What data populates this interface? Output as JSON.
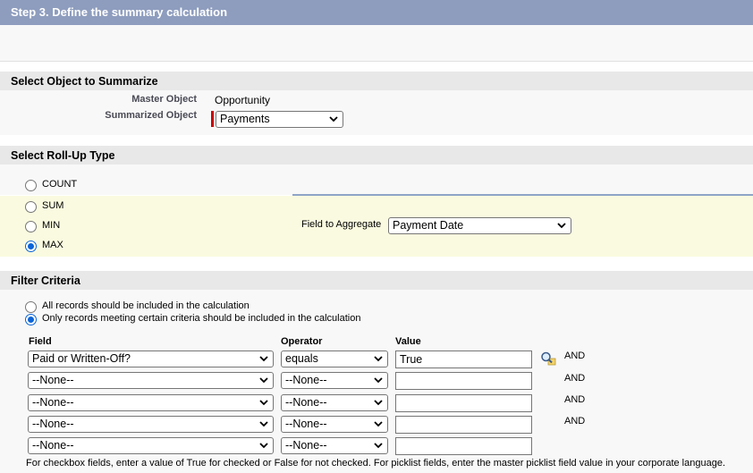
{
  "step_header": "Step 3. Define the summary calculation",
  "sections": {
    "object": "Select Object to Summarize",
    "rollup": "Select Roll-Up Type",
    "filter": "Filter Criteria"
  },
  "object": {
    "master_label": "Master Object",
    "master_value": "Opportunity",
    "summarized_label": "Summarized Object",
    "summarized_value": "Payments"
  },
  "rollup": {
    "options": [
      "COUNT",
      "SUM",
      "MIN",
      "MAX"
    ],
    "selected": "MAX",
    "aggregate_label": "Field to Aggregate",
    "aggregate_value": "Payment Date"
  },
  "filter": {
    "option_all": "All records should be included in the calculation",
    "option_some": "Only records meeting certain criteria should be included in the calculation",
    "selected": "some",
    "headers": {
      "field": "Field",
      "operator": "Operator",
      "value": "Value"
    },
    "rows": [
      {
        "field": "Paid or Written-Off?",
        "operator": "equals",
        "value": "True",
        "conj": "AND"
      },
      {
        "field": "--None--",
        "operator": "--None--",
        "value": "",
        "conj": "AND"
      },
      {
        "field": "--None--",
        "operator": "--None--",
        "value": "",
        "conj": "AND"
      },
      {
        "field": "--None--",
        "operator": "--None--",
        "value": "",
        "conj": "AND"
      },
      {
        "field": "--None--",
        "operator": "--None--",
        "value": "",
        "conj": ""
      }
    ],
    "help_text": "For checkbox fields, enter a value of True for checked or False for not checked. For picklist fields, enter the master picklist field value in your corporate language."
  },
  "icons": {
    "lookup": "lookup-magnifier-icon",
    "dropdown": "chevron-down-icon"
  },
  "colors": {
    "header_bg": "#8e9dbe",
    "radio_selected": "#0a64d8",
    "required": "#cc0000"
  }
}
